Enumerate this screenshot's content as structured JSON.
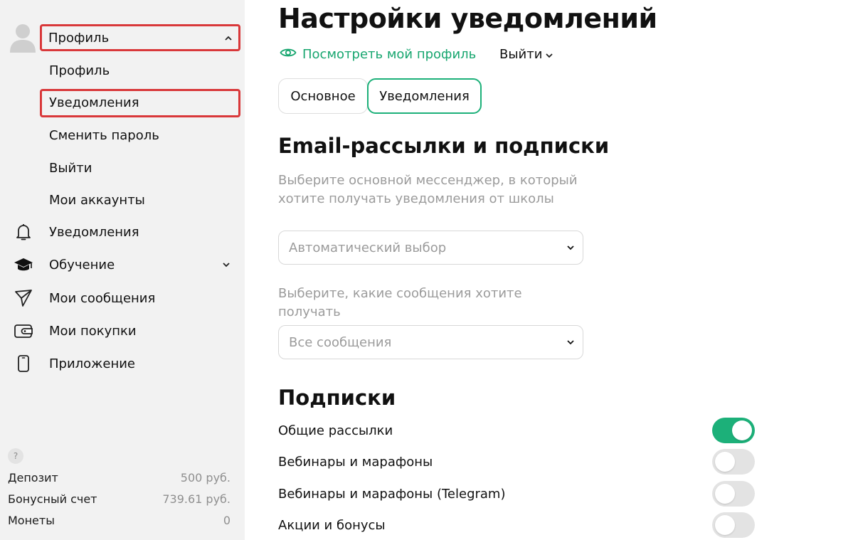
{
  "colors": {
    "accent": "#1cb079",
    "highlight_frame": "#d9383a",
    "sidebar_bg": "#f2f2f2"
  },
  "sidebar": {
    "profile_header": {
      "label": "Профиль",
      "icon": "chevron-up-icon"
    },
    "profile_sub_items": [
      {
        "label": "Профиль"
      },
      {
        "label": "Уведомления"
      },
      {
        "label": "Сменить пароль"
      },
      {
        "label": "Выйти"
      },
      {
        "label": "Мои аккаунты"
      }
    ],
    "nav_items": [
      {
        "label": "Уведомления",
        "icon": "bell-icon"
      },
      {
        "label": "Обучение",
        "icon": "graduation-cap-icon",
        "has_submenu": true
      },
      {
        "label": "Мои сообщения",
        "icon": "send-icon"
      },
      {
        "label": "Мои покупки",
        "icon": "wallet-icon"
      },
      {
        "label": "Приложение",
        "icon": "phone-icon"
      }
    ],
    "help_icon": "?",
    "balances": [
      {
        "label": "Депозит",
        "value": "500 руб."
      },
      {
        "label": "Бонусный счет",
        "value": "739.61 руб."
      },
      {
        "label": "Монеты",
        "value": "0"
      }
    ]
  },
  "main": {
    "title": "Настройки уведомлений",
    "view_profile_link": "Посмотреть мой профиль",
    "logout_label": "Выйти",
    "tabs": [
      {
        "label": "Основное",
        "active": false
      },
      {
        "label": "Уведомления",
        "active": true
      }
    ],
    "email_section": {
      "title": "Email-рассылки и подписки",
      "messenger_hint": "Выберите основной мессенджер, в который хотите получать уведомления от школы",
      "messenger_value": "Автоматический выбор",
      "messages_hint": "Выберите, какие сообщения хотите получать",
      "messages_value": "Все сообщения"
    },
    "subscriptions": {
      "title": "Подписки",
      "items": [
        {
          "label": "Общие рассылки",
          "enabled": true
        },
        {
          "label": "Вебинары и марафоны",
          "enabled": false
        },
        {
          "label": "Вебинары и марафоны (Telegram)",
          "enabled": false
        },
        {
          "label": "Акции и бонусы",
          "enabled": false
        }
      ]
    }
  }
}
